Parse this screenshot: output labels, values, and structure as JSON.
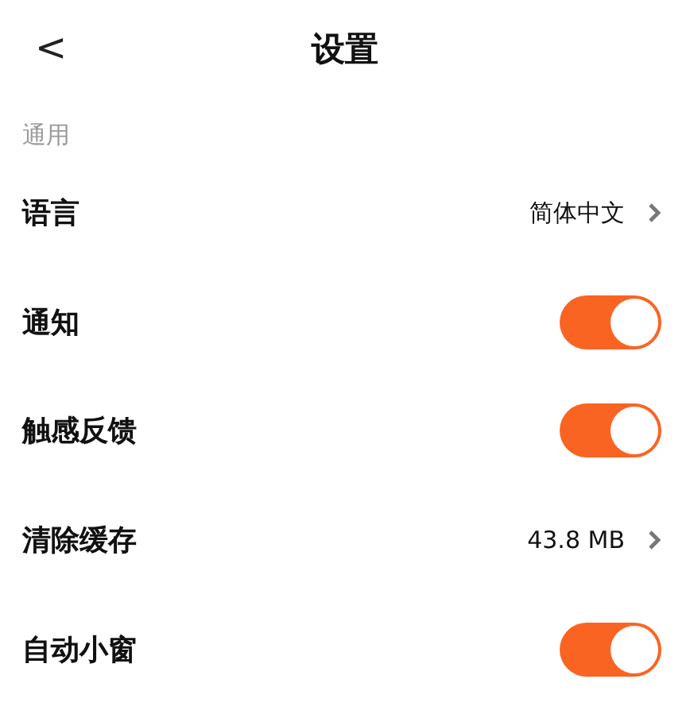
{
  "header": {
    "back": "<",
    "title": "设置"
  },
  "section": "通用",
  "rows": [
    {
      "kind": "link",
      "label": "语言",
      "value": "简体中文"
    },
    {
      "kind": "switch",
      "label": "通知",
      "on": true
    },
    {
      "kind": "switch",
      "label": "触感反馈",
      "on": true
    },
    {
      "kind": "link",
      "label": "清除缓存",
      "value": "43.8 MB"
    },
    {
      "kind": "switch",
      "label": "自动小窗",
      "on": true
    }
  ]
}
